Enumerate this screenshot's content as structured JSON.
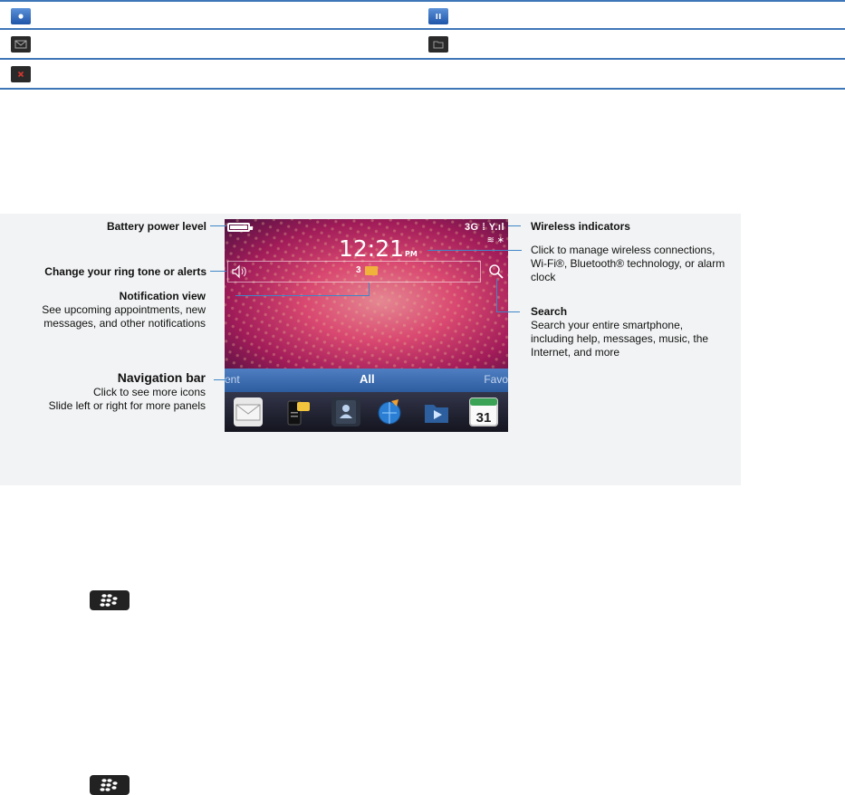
{
  "icon_table": {
    "rows": [
      {
        "left_icon": "record-icon",
        "right_icon": "pause-icon"
      },
      {
        "left_icon": "envelope-icon",
        "right_icon": "folder-icon"
      },
      {
        "left_icon": "close-x-icon",
        "right_icon": ""
      }
    ]
  },
  "figure": {
    "phone": {
      "network": "3G",
      "clock_time": "12:21",
      "clock_ampm": "PM",
      "notification_count": "3",
      "nav_left": "ent",
      "nav_center": "All",
      "nav_right": "Favo",
      "dock_icons": [
        "messages-icon",
        "bbm-icon",
        "contacts-icon",
        "browser-icon",
        "media-icon",
        "calendar-icon"
      ],
      "calendar_day": "31"
    },
    "labels": {
      "battery": "Battery power level",
      "ringtone": "Change your ring tone or alerts",
      "notification_title": "Notification view",
      "notification_desc_1": "See upcoming appointments, new",
      "notification_desc_2": "messages, and other notifications",
      "navigation_title": "Navigation bar",
      "navigation_desc_1": "Click to see more icons",
      "navigation_desc_2": "Slide left or right for more panels",
      "wireless_title": "Wireless indicators",
      "wireless_desc_1": "Click to manage wireless connections,",
      "wireless_desc_2": "Wi-Fi®, Bluetooth® technology, or alarm",
      "wireless_desc_3": "clock",
      "search_title": "Search",
      "search_desc_1": "Search your entire smartphone,",
      "search_desc_2": "including help, messages, music, the",
      "search_desc_3": "Internet, and more"
    }
  },
  "menu_keys": [
    "blackberry-menu-key-icon",
    "blackberry-menu-key-icon"
  ],
  "colors": {
    "rule": "#3f76b8",
    "callout": "#3f86c8",
    "navbar": "#3a69ad"
  }
}
